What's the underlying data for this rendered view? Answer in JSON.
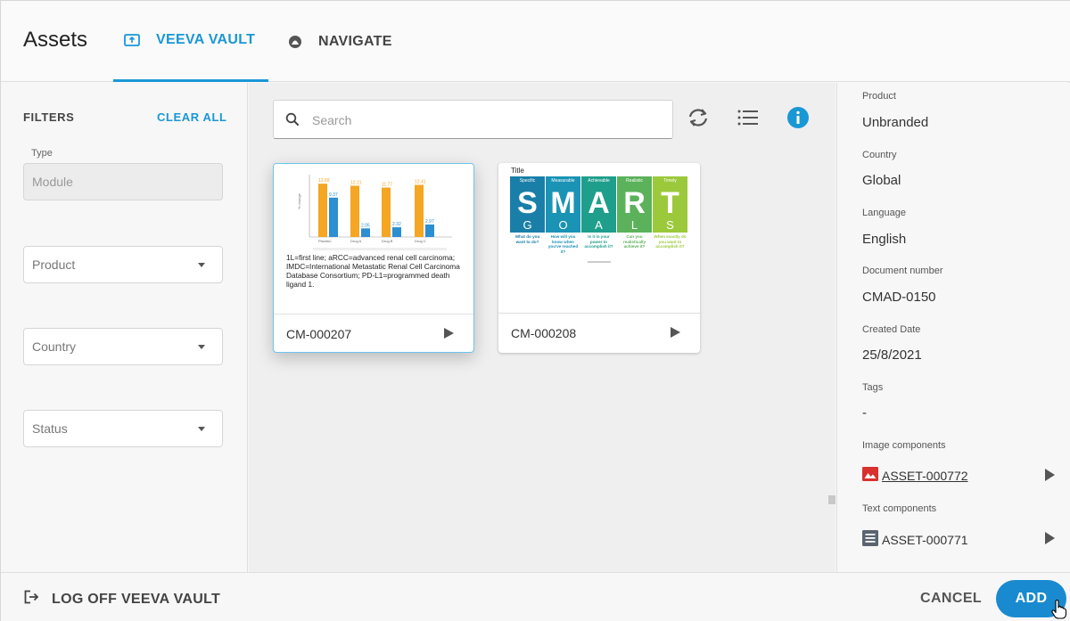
{
  "header": {
    "title": "Assets",
    "tabs": [
      {
        "label": "VEEVA VAULT",
        "icon": "vault-icon",
        "active": true
      },
      {
        "label": "NAVIGATE",
        "icon": "navigate-icon",
        "active": false
      }
    ]
  },
  "filters": {
    "title": "FILTERS",
    "clear_label": "CLEAR ALL",
    "type_label": "Type",
    "type_value": "Module",
    "product_placeholder": "Product",
    "country_placeholder": "Country",
    "status_placeholder": "Status"
  },
  "search": {
    "placeholder": "Search",
    "value": ""
  },
  "toolbar": {
    "icons": [
      "refresh-icon",
      "list-view-icon",
      "info-icon"
    ],
    "info_color": "#1a97d5"
  },
  "cards": [
    {
      "id": "CM-000207",
      "selected": true,
      "thumb": {
        "kind": "bar-chart",
        "bar_labels": [
          "12.69",
          "9.37",
          "12.21",
          "2.05",
          "11.77",
          "2.32",
          "12.41",
          "2.97"
        ],
        "categories": [
          "Placebo",
          "Drug A",
          "Drug B",
          "Drug C"
        ],
        "caption": "1L=first line; aRCC=advanced renal cell carcinoma; IMDC=International Metastatic Renal Cell Carcinoma Database Consortium; PD-L1=programmed death ligand 1."
      }
    },
    {
      "id": "CM-000208",
      "selected": false,
      "thumb": {
        "kind": "smart-goals",
        "title": "Title",
        "columns": [
          {
            "header": "Specific",
            "letter": "S",
            "word": "G",
            "question": "What do you want to do?",
            "color": "#1a7fa8"
          },
          {
            "header": "Measurable",
            "letter": "M",
            "word": "O",
            "question": "How will you know when you've reached it?",
            "color": "#1a93b5"
          },
          {
            "header": "Achievable",
            "letter": "A",
            "word": "A",
            "question": "Is it in your power to accomplish it?",
            "color": "#1f9e8c"
          },
          {
            "header": "Realistic",
            "letter": "R",
            "word": "L",
            "question": "Can you realistically achieve it?",
            "color": "#5bb25a"
          },
          {
            "header": "Timely",
            "letter": "T",
            "word": "S",
            "question": "When exactly do you want to accomplish it?",
            "color": "#9bc93b"
          }
        ]
      }
    }
  ],
  "details": {
    "fields": [
      {
        "label": "Product",
        "value": "Unbranded"
      },
      {
        "label": "Country",
        "value": "Global"
      },
      {
        "label": "Language",
        "value": "English"
      },
      {
        "label": "Document number",
        "value": "CMAD-0150"
      },
      {
        "label": "Created Date",
        "value": "25/8/2021"
      },
      {
        "label": "Tags",
        "value": "-"
      }
    ],
    "image_components_label": "Image components",
    "image_component": "ASSET-000772",
    "text_components_label": "Text components",
    "text_component": "ASSET-000771"
  },
  "footer": {
    "logoff_label": "LOG OFF VEEVA VAULT",
    "cancel_label": "CANCEL",
    "add_label": "ADD"
  },
  "colors": {
    "accent": "#1a97d5",
    "add_button": "#1a8ad0",
    "bar_orange": "#f5a623",
    "bar_blue": "#2b8fd1",
    "image_icon": "#d8312e",
    "text_icon": "#5a6470"
  }
}
